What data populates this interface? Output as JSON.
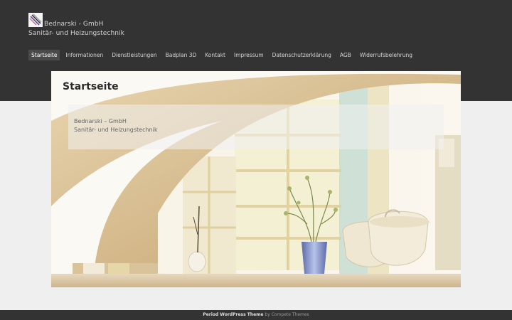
{
  "site": {
    "title": "Bednarski - GmbH",
    "tagline": "Sanitär- und Heizungstechnik",
    "logo_icon": "brush-logo-icon"
  },
  "nav": {
    "items": [
      {
        "label": "Startseite",
        "active": true
      },
      {
        "label": "Informationen"
      },
      {
        "label": "Dienstleistungen"
      },
      {
        "label": "Badplan 3D"
      },
      {
        "label": "Kontakt"
      },
      {
        "label": "Impressum"
      },
      {
        "label": "Datenschutzerklärung"
      },
      {
        "label": "AGB"
      },
      {
        "label": "Widerrufsbelehrung"
      }
    ]
  },
  "main": {
    "page_title": "Startseite",
    "caption_line1": "Bednarski – GmbH",
    "caption_line2": "Sanitär- und Heizungstechnik"
  },
  "footer": {
    "theme_name": "Period WordPress Theme",
    "by_text": "by Compete Themes"
  },
  "colors": {
    "header_bg": "#333333",
    "page_bg": "#efefef"
  }
}
